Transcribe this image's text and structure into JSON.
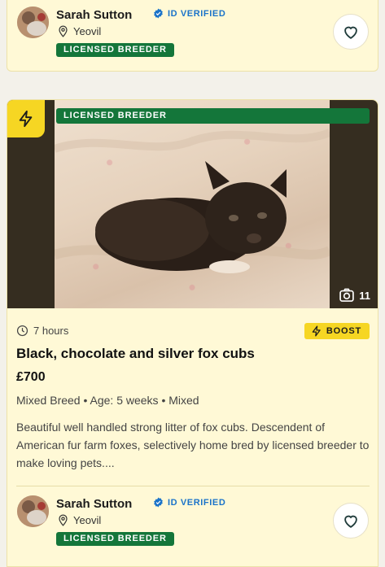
{
  "seller_top": {
    "name": "Sarah Sutton",
    "verified": "ID VERIFIED",
    "location": "Yeovil",
    "badge": "LICENSED BREEDER"
  },
  "listing": {
    "photo_badge": "LICENSED BREEDER",
    "photo_count": "11",
    "time_ago": "7 hours",
    "boost_label": "BOOST",
    "title": "Black, chocolate and silver fox cubs",
    "price": "£700",
    "meta": "Mixed Breed • Age: 5 weeks • Mixed",
    "description": "Beautiful well handled strong litter of fox cubs. Descendent of American fur farm foxes, selectively home bred by licensed breeder to make loving pets....",
    "seller": {
      "name": "Sarah Sutton",
      "verified": "ID VERIFIED",
      "location": "Yeovil",
      "badge": "LICENSED BREEDER"
    }
  },
  "icons": {
    "favourite": "heart-outline-icon",
    "verified": "verified-check-icon",
    "location": "location-pin-icon",
    "boost": "lightning-icon",
    "photos": "camera-icon",
    "time": "clock-icon"
  },
  "colors": {
    "card_bg": "#fff9d6",
    "licensed_green": "#14763a",
    "verified_blue": "#1a73c9",
    "boost_yellow": "#f6d623"
  }
}
